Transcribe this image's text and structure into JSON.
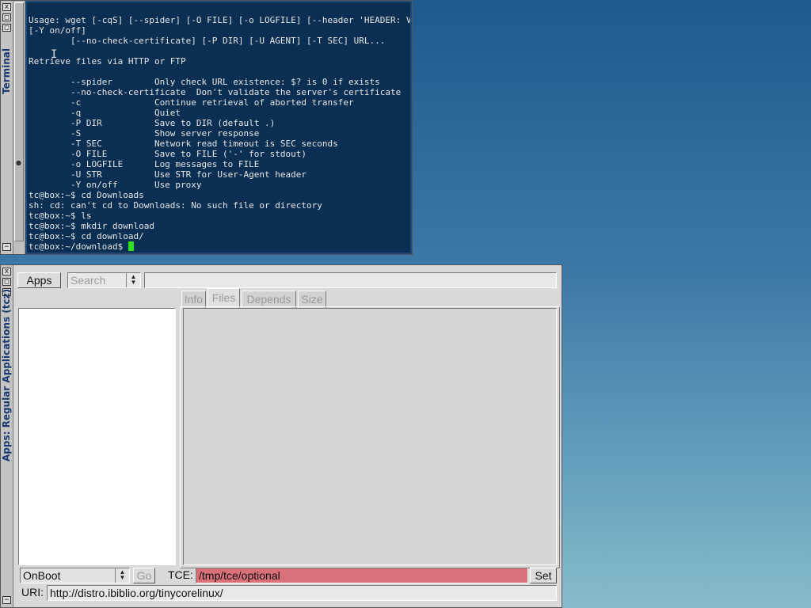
{
  "terminal_window": {
    "title": "Terminal",
    "buttons": {
      "close": "x",
      "maximize": "□",
      "iconify": "□",
      "shade": "−"
    },
    "lines": [
      "Usage: wget [-cqS] [--spider] [-O FILE] [-o LOGFILE] [--header 'HEADER: VALUE']",
      "[-Y on/off]",
      "        [--no-check-certificate] [-P DIR] [-U AGENT] [-T SEC] URL...",
      "",
      "Retrieve files via HTTP or FTP",
      "",
      "        --spider        Only check URL existence: $? is 0 if exists",
      "        --no-check-certificate  Don't validate the server's certificate",
      "        -c              Continue retrieval of aborted transfer",
      "        -q              Quiet",
      "        -P DIR          Save to DIR (default .)",
      "        -S              Show server response",
      "        -T SEC          Network read timeout is SEC seconds",
      "        -O FILE         Save to FILE ('-' for stdout)",
      "        -o LOGFILE      Log messages to FILE",
      "        -U STR          Use STR for User-Agent header",
      "        -Y on/off       Use proxy",
      "tc@box:~$ cd Downloads",
      "sh: cd: can't cd to Downloads: No such file or directory",
      "tc@box:~$ ls",
      "tc@box:~$ mkdir download",
      "tc@box:~$ cd download/",
      "tc@box:~/download$ "
    ],
    "cursor_color": "#2fe01f",
    "background_color": "#0b2f52"
  },
  "apps_window": {
    "title": "Apps: Regular Applications (tcz)",
    "buttons": {
      "close": "x",
      "maximize": "□",
      "iconify": "□",
      "shade": "−"
    },
    "apps_button": "Apps",
    "search": {
      "value": "Search"
    },
    "tabs": [
      {
        "label": "Info",
        "active": false
      },
      {
        "label": "Files",
        "active": true
      },
      {
        "label": "Depends",
        "active": false
      },
      {
        "label": "Size",
        "active": false
      }
    ],
    "footer": {
      "mode_select": "OnBoot",
      "go_button": "Go",
      "tce_label": "TCE:",
      "tce_value": "/tmp/tce/optional",
      "tce_field_color": "#d9707a",
      "set_button": "Set",
      "uri_label": "URI:",
      "uri_value": "http://distro.ibiblio.org/tinycorelinux/"
    }
  }
}
